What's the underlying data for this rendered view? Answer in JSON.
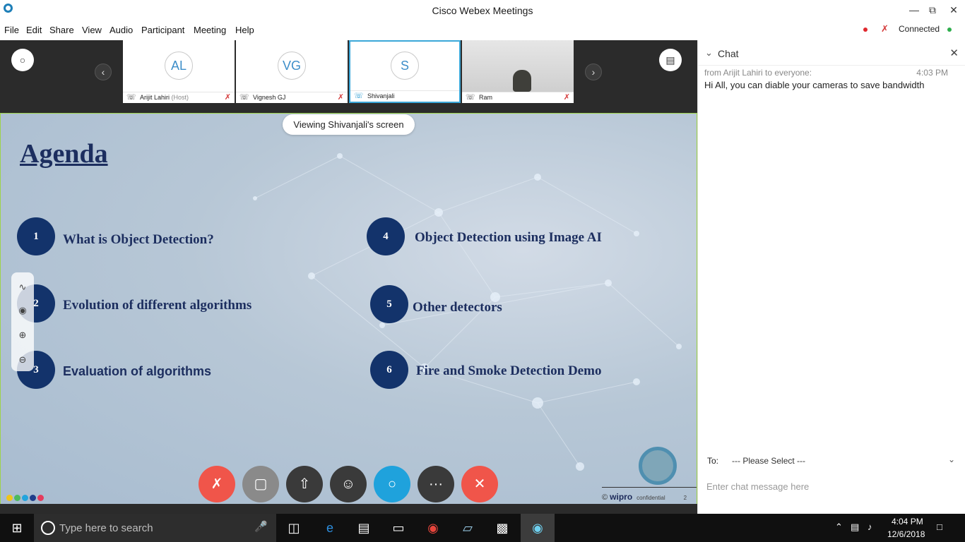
{
  "window": {
    "title": "Cisco Webex Meetings",
    "controls": [
      "minimize-icon",
      "restore-icon",
      "close-icon"
    ]
  },
  "menu": {
    "items": [
      "File",
      "Edit",
      "Share",
      "View",
      "Audio",
      "Participant",
      "Meeting",
      "Help"
    ],
    "status": "Connected"
  },
  "participants": [
    {
      "initials": "AL",
      "name": "Arijit Lahiri",
      "role": "(Host)",
      "muted": true
    },
    {
      "initials": "VG",
      "name": "Vignesh GJ",
      "muted": true
    },
    {
      "initials": "S",
      "name": "Shivanjali",
      "active": true
    },
    {
      "name": "Ram",
      "video": true,
      "muted": true
    }
  ],
  "share": {
    "viewing_label": "Viewing Shivanjali's screen",
    "slide_title": "Agenda",
    "items": [
      {
        "number": "1",
        "text": "What is Object Detection?"
      },
      {
        "number": "2",
        "text": "Evolution of different algorithms"
      },
      {
        "number": "3",
        "text": "Evaluation of algorithms"
      },
      {
        "number": "4",
        "text": "Object Detection using Image AI"
      },
      {
        "number": "5",
        "text": "Other detectors"
      },
      {
        "number": "6",
        "text": "Fire and Smoke Detection Demo"
      }
    ],
    "footer": {
      "copyright": "©",
      "brand": "wipro",
      "confidential": "confidential",
      "page": "2"
    }
  },
  "controls": {
    "buttons": [
      "mute-button",
      "video-button",
      "share-button",
      "participants-button",
      "chat-button",
      "more-button",
      "end-meeting-button"
    ],
    "more_label": "···",
    "colors": {
      "mute": "#f0554a",
      "video": "#8a8a8a",
      "dark": "#3a3a3a",
      "chat": "#1fa2dc",
      "end": "#f0554a"
    }
  },
  "chat": {
    "title": "Chat",
    "messages": [
      {
        "from": "from Arijit Lahiri to everyone:",
        "time": "4:03 PM",
        "text": "Hi All, you can diable your cameras to save bandwidth"
      }
    ],
    "to_label": "To:",
    "to_value": "--- Please Select ---",
    "input_placeholder": "Enter chat message here"
  },
  "taskbar": {
    "search_placeholder": "Type here to search",
    "time": "4:04 PM",
    "date": "12/6/2018"
  }
}
